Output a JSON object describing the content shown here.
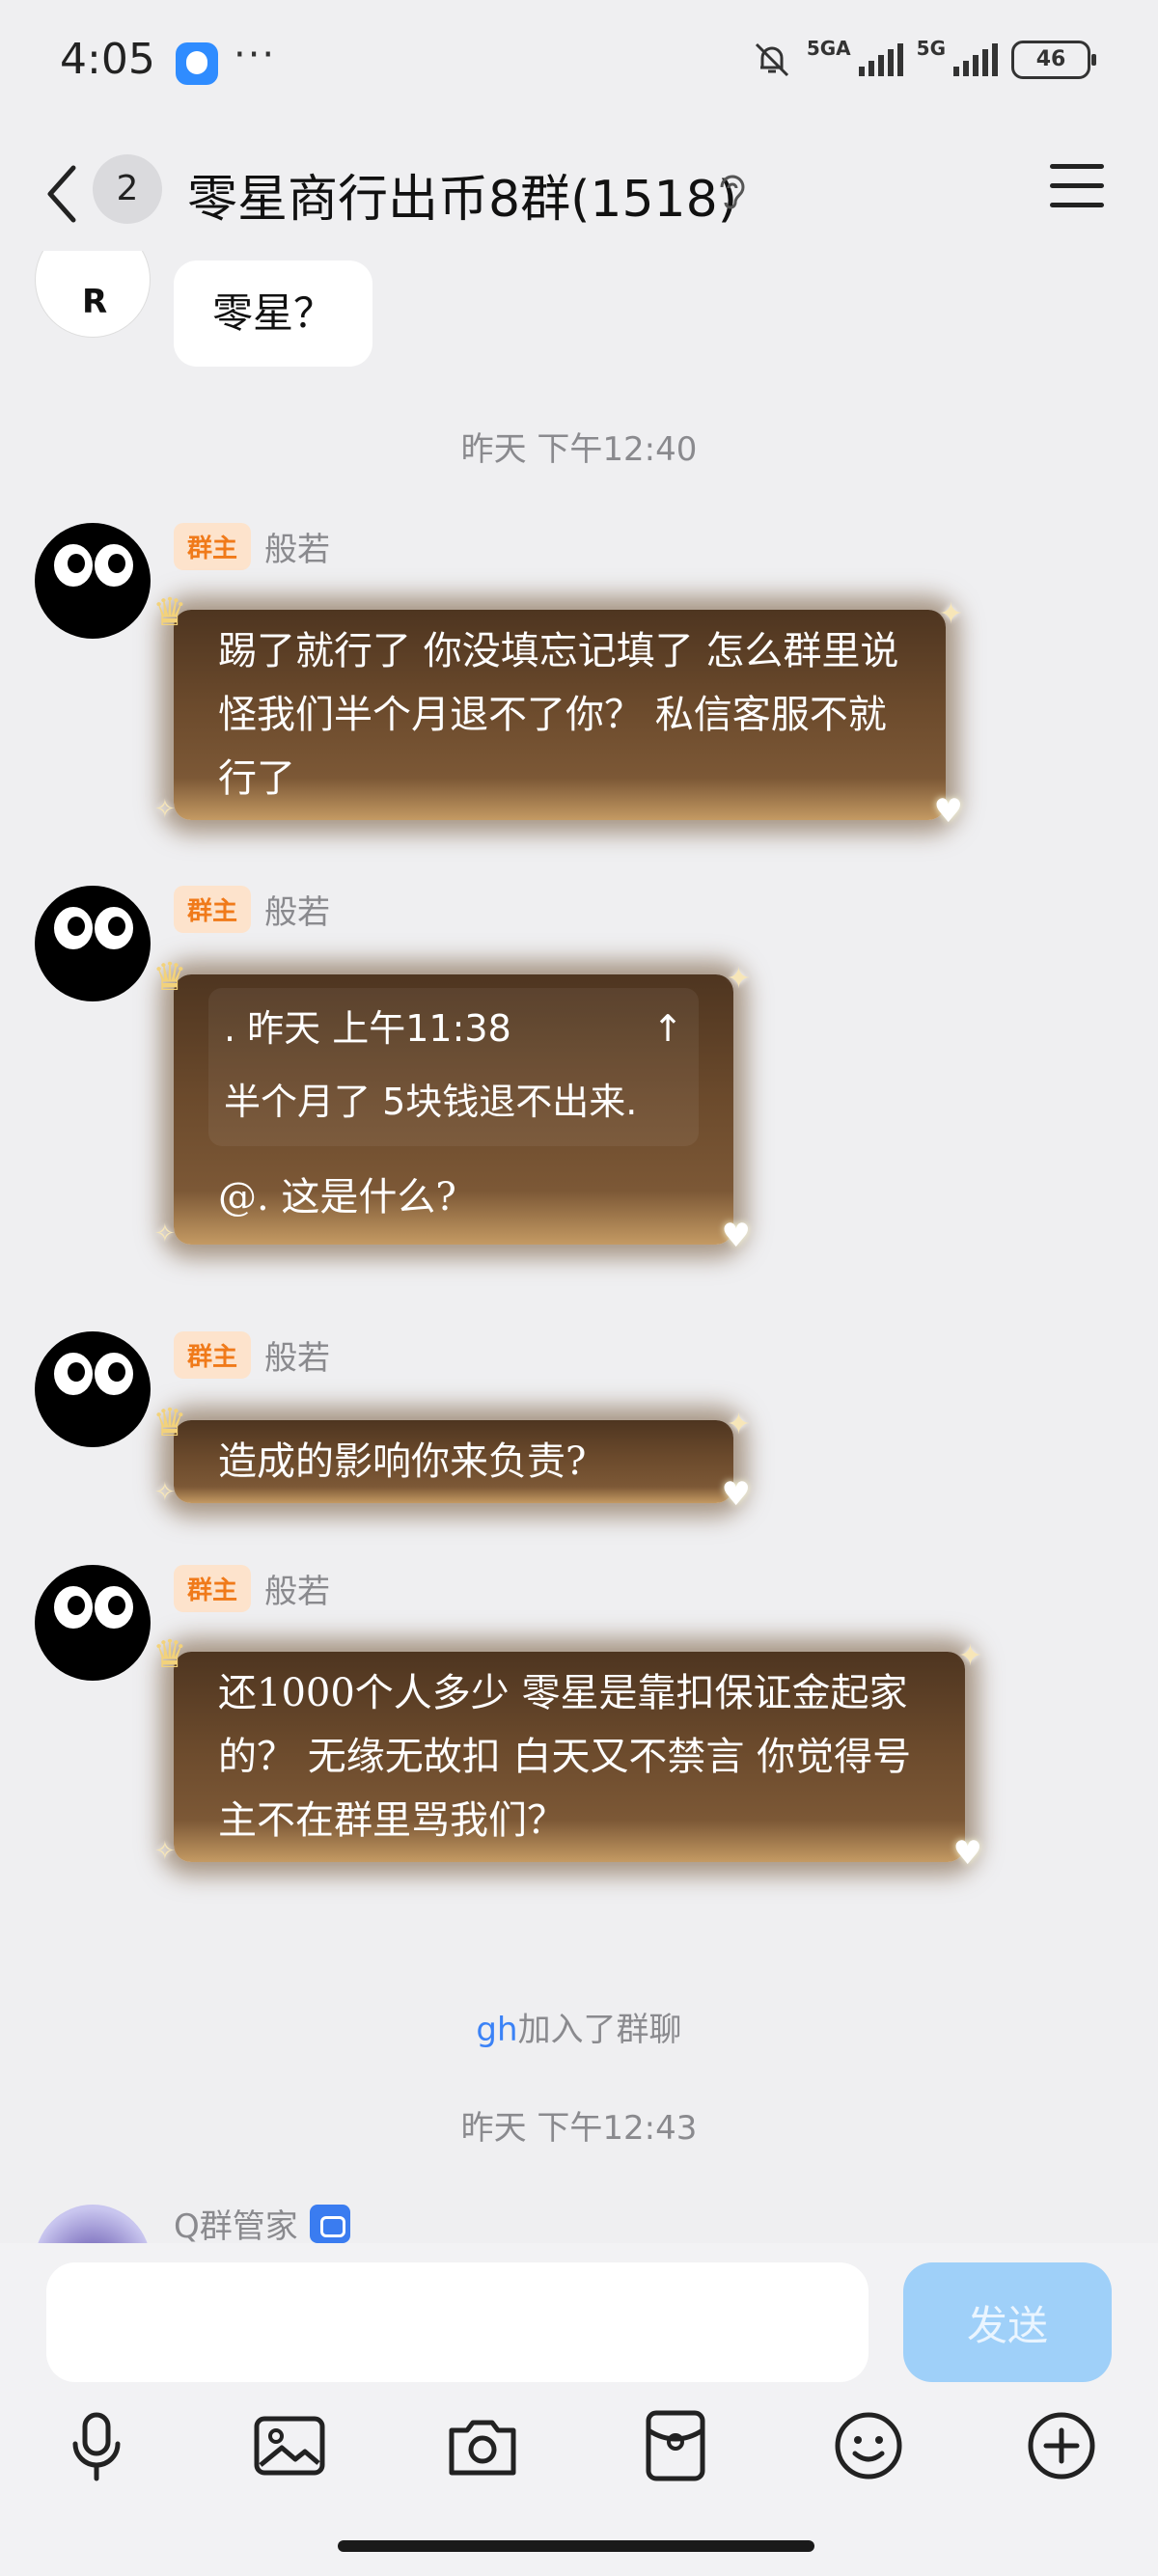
{
  "status_bar": {
    "time": "4:05",
    "dots": "···",
    "net1": "5GA",
    "net2": "5G",
    "battery": "46"
  },
  "header": {
    "unread_count": "2",
    "title": "零星商行出币8群(1518)"
  },
  "messages": {
    "m0": {
      "text": "零星？",
      "avatar_letter": "R"
    },
    "ts1": "昨天 下午12:40",
    "m1": {
      "tag": "群主",
      "name": "般若",
      "text": "踢了就行了 你没填忘记填了 怎么群里说怪我们半个月退不了你？ 私信客服不就行了"
    },
    "m2": {
      "tag": "群主",
      "name": "般若",
      "quote_meta": ". 昨天 上午11:38",
      "quote_arrow": "↑",
      "quote_text": "半个月了 5块钱退不出来.",
      "text": "@. 这是什么?"
    },
    "m3": {
      "tag": "群主",
      "name": "般若",
      "text": "造成的影响你来负责?"
    },
    "m4": {
      "tag": "群主",
      "name": "般若",
      "text": "还1000个人多少 零星是靠扣保证金起家的？ 无缘无故扣 白天又不禁言 你觉得号主不在群里骂我们？"
    },
    "join": {
      "name": "gh",
      "suffix": "加入了群聊"
    },
    "ts2": "昨天 下午12:43",
    "bot": {
      "name": "Q群管家"
    }
  },
  "composer": {
    "input_value": "",
    "send_label": "发送"
  },
  "toolbar": {
    "icons": [
      "microphone-icon",
      "image-icon",
      "camera-icon",
      "red-packet-icon",
      "emoji-icon",
      "plus-icon"
    ]
  },
  "colors": {
    "background": "#efeff1",
    "owner_tag_bg": "#fde3cc",
    "owner_tag_text": "#f07a1a",
    "send_button": "#9fd0f9",
    "link_blue": "#3b82f6"
  }
}
